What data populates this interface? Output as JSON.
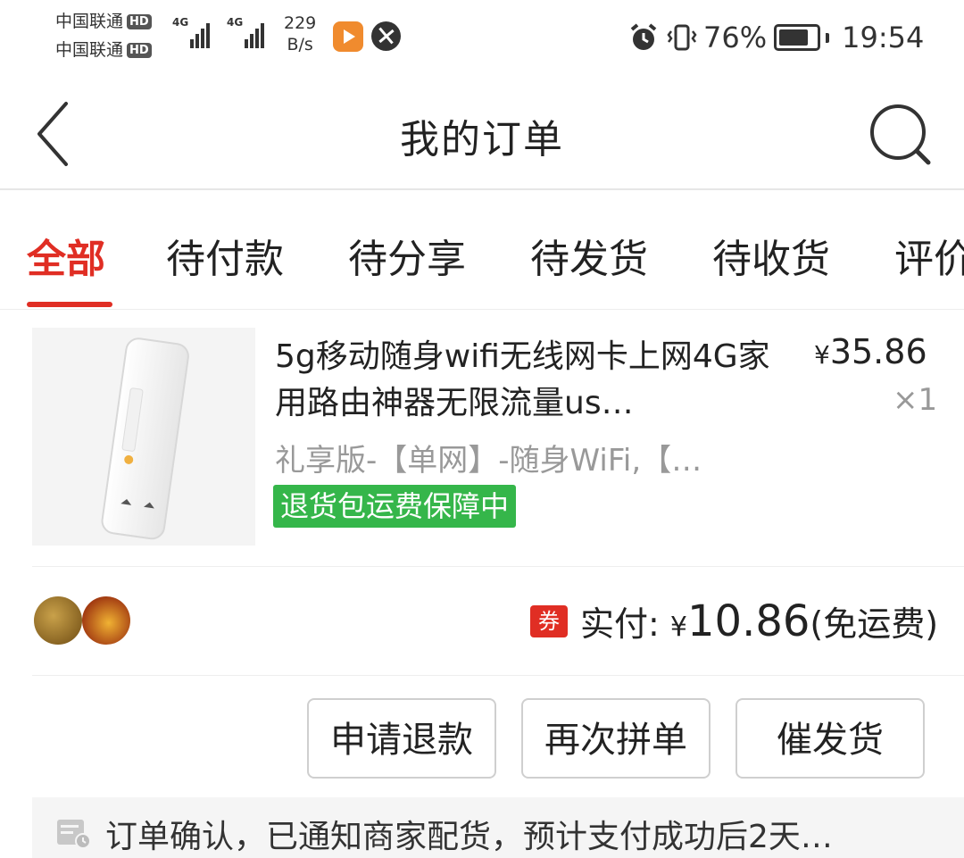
{
  "status_bar": {
    "carrier_1": "中国联通",
    "carrier_2": "中国联通",
    "hd_label": "HD",
    "net_1": "4G",
    "net_2": "4G",
    "speed_value": "229",
    "speed_unit": "B/s",
    "battery": "76%",
    "time": "19:54"
  },
  "nav": {
    "title": "我的订单"
  },
  "tabs": [
    {
      "label": "全部",
      "active": true
    },
    {
      "label": "待付款"
    },
    {
      "label": "待分享"
    },
    {
      "label": "待发货"
    },
    {
      "label": "待收货"
    },
    {
      "label": "评价"
    }
  ],
  "order": {
    "product_name": "5g移动随身wifi无线网卡上网4G家用路由神器无限流量us…",
    "price_symbol": "¥",
    "price": "35.86",
    "quantity": "×1",
    "spec": "礼享版-【单网】-随身WiFi,【…",
    "badge": "退货包运费保障中",
    "coupon_label": "券",
    "paid_label": "实付:",
    "paid_symbol": "¥",
    "paid_amount": "10.86",
    "shipping_note": "(免运费)"
  },
  "actions": {
    "refund": "申请退款",
    "reorder": "再次拼单",
    "urge": "催发货"
  },
  "notice": {
    "text": "订单确认，已通知商家配货，预计支付成功后2天…"
  },
  "colors": {
    "accent": "#e02e24",
    "badge_green": "#35b64a",
    "muted_text": "#999999"
  }
}
